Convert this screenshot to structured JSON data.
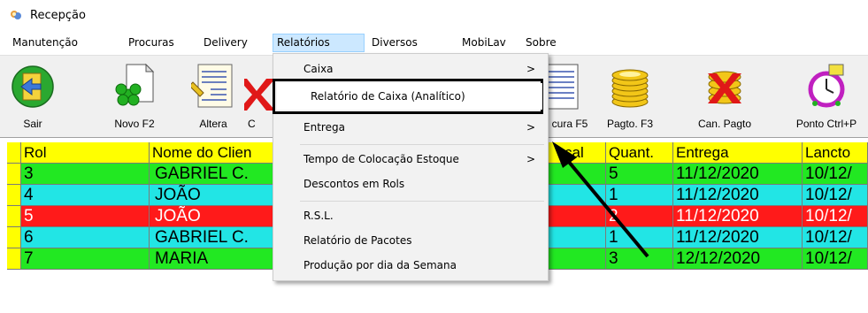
{
  "window": {
    "title": "Recepção"
  },
  "menubar": {
    "items": [
      "Manutenção",
      "Procuras",
      "Delivery",
      "Relatórios",
      "Diversos",
      "MobiLav",
      "Sobre"
    ],
    "active": "Relatórios"
  },
  "toolbar": {
    "buttons": [
      {
        "label": "Sair",
        "icon": "exit-door-icon"
      },
      {
        "label": "Novo F2",
        "icon": "new-document-icon"
      },
      {
        "label": "Altera",
        "icon": "edit-document-icon"
      },
      {
        "label": "C",
        "icon": "cancel-icon"
      },
      {
        "label": "cura F5",
        "icon": "search-document-icon"
      },
      {
        "label": "Pagto. F3",
        "icon": "coins-icon"
      },
      {
        "label": "Can. Pagto",
        "icon": "cancel-payment-icon"
      },
      {
        "label": "Ponto Ctrl+P",
        "icon": "clock-icon"
      }
    ]
  },
  "dropdown": {
    "items": [
      {
        "label": "Caixa",
        "submenu": true
      },
      {
        "label": "Relatório de Caixa (Analítico)",
        "submenu": false
      },
      {
        "label": "Entrega",
        "submenu": true
      },
      {
        "label": "Tempo de Colocação Estoque",
        "submenu": true
      },
      {
        "label": "Descontos em Rols",
        "submenu": false
      },
      {
        "label": "R.S.L.",
        "submenu": false
      },
      {
        "label": "Relatório de Pacotes",
        "submenu": false
      },
      {
        "label": "Produção por dia da Semana",
        "submenu": false
      }
    ],
    "submenu_arrow": ">"
  },
  "grid": {
    "columns": [
      "Rol",
      "Nome do Clien",
      "cal",
      "Quant.",
      "Entrega",
      "Lancto"
    ],
    "rows": [
      {
        "rol": "3",
        "nome": "GABRIEL C.",
        "quant": "5",
        "entrega": "11/12/2020",
        "lancto": "10/12/",
        "color": "#22e822"
      },
      {
        "rol": "4",
        "nome": "JOÃO",
        "quant": "1",
        "entrega": "11/12/2020",
        "lancto": "10/12/",
        "color": "#22e5e5"
      },
      {
        "rol": "5",
        "nome": "JOÃO",
        "quant": "2",
        "entrega": "11/12/2020",
        "lancto": "10/12/",
        "color": "#ff1a1a"
      },
      {
        "rol": "6",
        "nome": "GABRIEL C.",
        "quant": "1",
        "entrega": "11/12/2020",
        "lancto": "10/12/",
        "color": "#22e5e5"
      },
      {
        "rol": "7",
        "nome": "MARIA",
        "quant": "3",
        "entrega": "12/12/2020",
        "lancto": "10/12/",
        "color": "#22e822"
      }
    ]
  },
  "colors": {
    "header_bg": "#ffff00",
    "menu_highlight": "#cce8ff",
    "toolbar_bg": "#f0f0f0"
  }
}
